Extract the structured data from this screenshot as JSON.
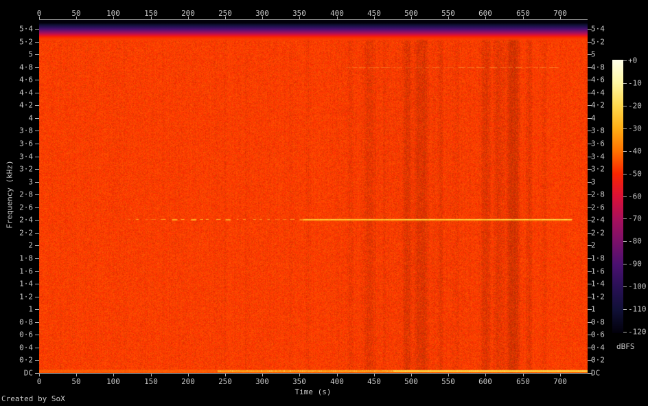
{
  "credit": "Created by SoX",
  "time_axis": {
    "label": "Time (s)",
    "ticks": [
      "0",
      "50",
      "100",
      "150",
      "200",
      "250",
      "300",
      "350",
      "400",
      "450",
      "500",
      "550",
      "600",
      "650",
      "700"
    ]
  },
  "freq_axis": {
    "label": "Frequency (kHz)",
    "ticks": [
      "5·4",
      "5·2",
      "5",
      "4·8",
      "4·6",
      "4·4",
      "4·2",
      "4",
      "3·8",
      "3·6",
      "3·4",
      "3·2",
      "3",
      "2·8",
      "2·6",
      "2·4",
      "2·2",
      "2",
      "1·8",
      "1·6",
      "1·4",
      "1·2",
      "1",
      "0·8",
      "0·6",
      "0·4",
      "0·2",
      "DC"
    ]
  },
  "colorbar": {
    "unit": "dBFS",
    "ticks": [
      "+0",
      "-10",
      "-20",
      "-30",
      "-40",
      "-50",
      "-60",
      "-70",
      "-80",
      "-90",
      "-100",
      "-110",
      "-120"
    ],
    "gradient": [
      "#ffffe9",
      "#fff7a3",
      "#ffd94e",
      "#ffae15",
      "#ff7300",
      "#fa2600",
      "#dc1136",
      "#a8105c",
      "#7a106a",
      "#4a1070",
      "#281055",
      "#101036",
      "#02000a"
    ]
  },
  "chart_data": {
    "type": "heatmap",
    "subtype": "spectrogram",
    "xlabel": "Time (s)",
    "ylabel": "Frequency (kHz)",
    "zlabel": "dBFS",
    "x_range_s": [
      0,
      737
    ],
    "y_range_khz": [
      0,
      5.54
    ],
    "z_range_dbfs": [
      -120,
      0
    ],
    "x_tick_step_s": 50,
    "y_tick_step_khz": 0.2,
    "background_color": "#f43e00",
    "background_level_dbfs": -45,
    "features": {
      "hf_rolloff": {
        "freq_khz": [
          5.25,
          5.54
        ],
        "desc": "energy falls from ~-45 dBFS background to -120 dBFS approaching Nyquist"
      },
      "tone_2k4": {
        "freq_khz": 2.4,
        "intermittent_s": [
          120,
          355
        ],
        "solid_s": [
          355,
          716
        ],
        "approx_level_dbfs": -20
      },
      "tone_4k8": {
        "freq_khz": 4.8,
        "span_s": [
          412,
          694
        ],
        "approx_level_dbfs": -35
      },
      "dc_band": {
        "freq_khz": 0.05,
        "faint_from_s": 0,
        "bright_from_s": 240,
        "brightest_from_s": 476,
        "approx_level_dbfs": -18
      },
      "quiet_stripes_s": [
        [
          247,
          252,
          0.96
        ],
        [
          275,
          281,
          0.96
        ],
        [
          335,
          342,
          0.96
        ],
        [
          358,
          365,
          0.95
        ],
        [
          390,
          680,
          0.975
        ],
        [
          413,
          423,
          0.93
        ],
        [
          435,
          453,
          0.9
        ],
        [
          461,
          466,
          0.93
        ],
        [
          487,
          501,
          0.88
        ],
        [
          504,
          524,
          0.86
        ],
        [
          534,
          543,
          0.92
        ],
        [
          557,
          564,
          0.94
        ],
        [
          593,
          607,
          0.88
        ],
        [
          610,
          626,
          0.9
        ],
        [
          626,
          647,
          0.82
        ],
        [
          653,
          663,
          0.9
        ],
        [
          675,
          682,
          0.93
        ]
      ]
    }
  }
}
